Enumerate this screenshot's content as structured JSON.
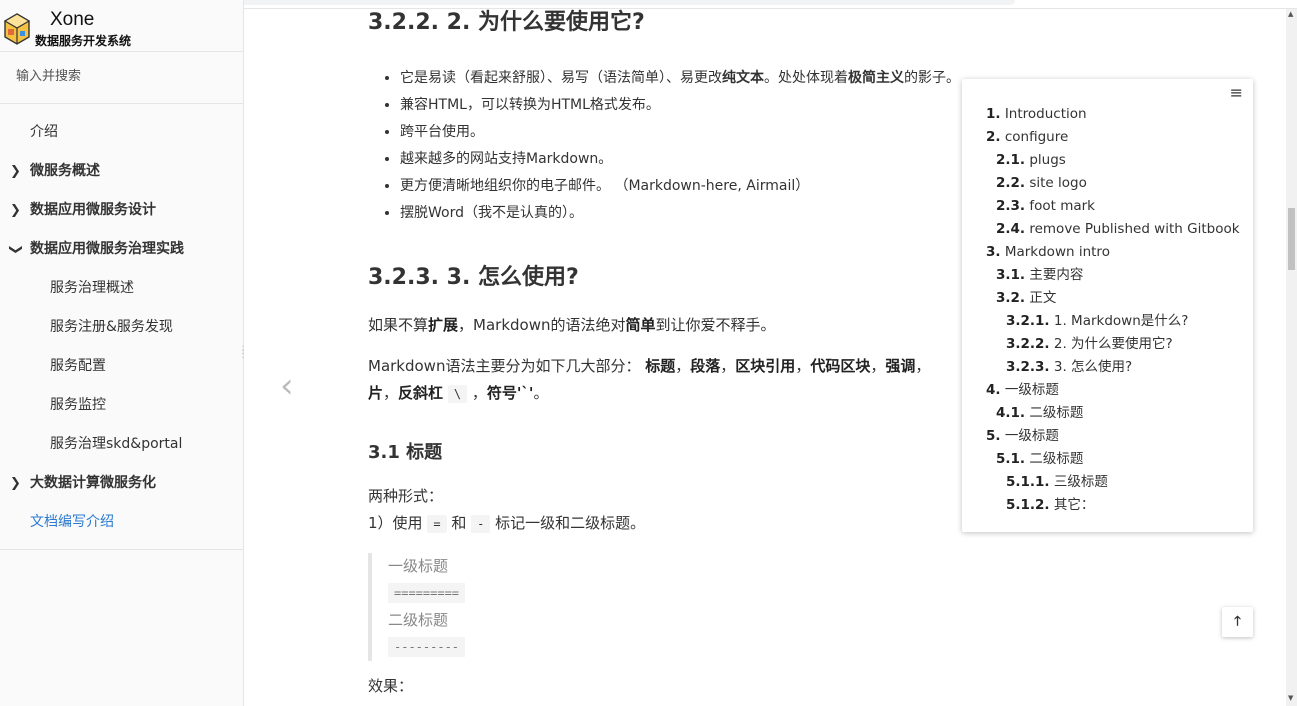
{
  "app": {
    "name": "Xone",
    "subtitle": "数据服务开发系统"
  },
  "search": {
    "placeholder": "输入并搜索"
  },
  "nav": [
    {
      "label": "介绍",
      "chevron": "",
      "level": 1,
      "bold": false
    },
    {
      "label": "微服务概述",
      "chevron": "❯",
      "level": 1,
      "bold": true
    },
    {
      "label": "数据应用微服务设计",
      "chevron": "❯",
      "level": 1,
      "bold": true
    },
    {
      "label": "数据应用微服务治理实践",
      "chevron": "❯",
      "level": 1,
      "bold": true
    },
    {
      "label": "服务治理概述",
      "chevron": "",
      "level": 2,
      "bold": false
    },
    {
      "label": "服务注册&服务发现",
      "chevron": "",
      "level": 2,
      "bold": false
    },
    {
      "label": "服务配置",
      "chevron": "",
      "level": 2,
      "bold": false
    },
    {
      "label": "服务监控",
      "chevron": "",
      "level": 2,
      "bold": false
    },
    {
      "label": "服务治理skd&portal",
      "chevron": "",
      "level": 2,
      "bold": false
    },
    {
      "label": "大数据计算微服务化",
      "chevron": "❯",
      "level": 1,
      "bold": true
    },
    {
      "label": "文档编写介绍",
      "chevron": "",
      "level": 1,
      "bold": false,
      "active": true
    }
  ],
  "content": {
    "h_322": "3.2.2. 2. 为什么要使用它?",
    "bullets": [
      [
        "它是易读（看起来舒服）、易写（语法简单）、易更改",
        "纯文本",
        "。处处体现着",
        "极简主义",
        "的影子。"
      ],
      [
        "兼容HTML，可以转换为HTML格式发布。"
      ],
      [
        "跨平台使用。"
      ],
      [
        "越来越多的网站支持Markdown。"
      ],
      [
        "更方便清晰地组织你的电子邮件。 （Markdown-here, Airmail）"
      ],
      [
        "摆脱Word（我不是认真的）。"
      ]
    ],
    "h_323": "3.2.3. 3. 怎么使用?",
    "p1": [
      "如果不算",
      "扩展",
      "，Markdown的语法绝对",
      "简单",
      "到让你爱不释手。"
    ],
    "p2_line1": [
      "Markdown语法主要分为如下几大部分： ",
      "标题",
      "，",
      "段落",
      "，",
      "区块引用",
      "，",
      "代码区块",
      "，",
      "强调",
      "，"
    ],
    "p2_line2": [
      "片",
      "，",
      "反斜杠",
      " ",
      "\\",
      " ，",
      "符号'`'",
      "。"
    ],
    "h_31": "3.1 标题",
    "forms_title": "两种形式：",
    "forms_line": [
      "1）使用 ",
      "=",
      " 和 ",
      "-",
      " 标记一级和二级标题。"
    ],
    "quote": {
      "l1": "一级标题",
      "c1": "=========",
      "l2": "二级标题",
      "c2": "---------"
    },
    "effect": "效果："
  },
  "toc": [
    {
      "num": "1.",
      "text": "Introduction",
      "indent": 0
    },
    {
      "num": "2.",
      "text": "configure",
      "indent": 0
    },
    {
      "num": "2.1.",
      "text": "plugs",
      "indent": 1
    },
    {
      "num": "2.2.",
      "text": "site logo",
      "indent": 1
    },
    {
      "num": "2.3.",
      "text": "foot mark",
      "indent": 1
    },
    {
      "num": "2.4.",
      "text": "remove Published with Gitbook",
      "indent": 1
    },
    {
      "num": "3.",
      "text": "Markdown intro",
      "indent": 0
    },
    {
      "num": "3.1.",
      "text": "主要内容",
      "indent": 1
    },
    {
      "num": "3.2.",
      "text": "正文",
      "indent": 1
    },
    {
      "num": "3.2.1.",
      "text": "1. Markdown是什么?",
      "indent": 2
    },
    {
      "num": "3.2.2.",
      "text": "2. 为什么要使用它?",
      "indent": 2
    },
    {
      "num": "3.2.3.",
      "text": "3. 怎么使用?",
      "indent": 2
    },
    {
      "num": "4.",
      "text": "一级标题",
      "indent": 0
    },
    {
      "num": "4.1.",
      "text": "二级标题",
      "indent": 1
    },
    {
      "num": "5.",
      "text": "一级标题",
      "indent": 0
    },
    {
      "num": "5.1.",
      "text": "二级标题",
      "indent": 1
    },
    {
      "num": "5.1.1.",
      "text": "三级标题",
      "indent": 2
    },
    {
      "num": "5.1.2.",
      "text": "其它：",
      "indent": 2
    }
  ],
  "icons": {
    "toc_menu": "≡",
    "back_to_top": "🡑",
    "prev_page": "‹"
  }
}
